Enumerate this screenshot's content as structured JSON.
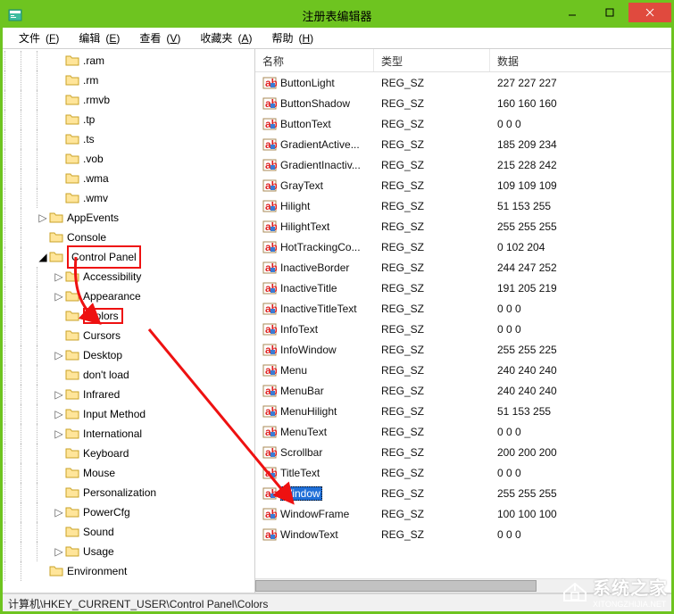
{
  "window": {
    "title": "注册表编辑器"
  },
  "menu": {
    "file": {
      "label": "文件",
      "accel": "F"
    },
    "edit": {
      "label": "编辑",
      "accel": "E"
    },
    "view": {
      "label": "查看",
      "accel": "V"
    },
    "favorites": {
      "label": "收藏夹",
      "accel": "A"
    },
    "help": {
      "label": "帮助",
      "accel": "H"
    }
  },
  "tree": {
    "ext_above": [
      ".ram",
      ".rm",
      ".rmvb",
      ".tp",
      ".ts",
      ".vob",
      ".wma",
      ".wmv"
    ],
    "nodes": [
      {
        "label": "AppEvents",
        "expander": "closed"
      },
      {
        "label": "Console",
        "expander": "none"
      }
    ],
    "control_panel": {
      "label": "Control Panel",
      "expander": "open",
      "highlight": true
    },
    "cp_children": [
      {
        "label": "Accessibility",
        "expander": "closed"
      },
      {
        "label": "Appearance",
        "expander": "closed"
      },
      {
        "label": "Colors",
        "expander": "none",
        "highlight": true
      },
      {
        "label": "Cursors",
        "expander": "none"
      },
      {
        "label": "Desktop",
        "expander": "closed"
      },
      {
        "label": "don't load",
        "expander": "none"
      },
      {
        "label": "Infrared",
        "expander": "closed"
      },
      {
        "label": "Input Method",
        "expander": "closed"
      },
      {
        "label": "International",
        "expander": "closed"
      },
      {
        "label": "Keyboard",
        "expander": "none"
      },
      {
        "label": "Mouse",
        "expander": "none"
      },
      {
        "label": "Personalization",
        "expander": "none"
      },
      {
        "label": "PowerCfg",
        "expander": "closed"
      },
      {
        "label": "Sound",
        "expander": "none"
      },
      {
        "label": "Usage",
        "expander": "closed"
      }
    ],
    "env": {
      "label": "Environment",
      "expander": "none"
    }
  },
  "list": {
    "columns": {
      "name": "名称",
      "type": "类型",
      "data": "数据"
    },
    "rows": [
      {
        "name": "ButtonLight",
        "type": "REG_SZ",
        "data": "227 227 227"
      },
      {
        "name": "ButtonShadow",
        "type": "REG_SZ",
        "data": "160 160 160"
      },
      {
        "name": "ButtonText",
        "type": "REG_SZ",
        "data": "0 0 0"
      },
      {
        "name": "GradientActive...",
        "type": "REG_SZ",
        "data": "185 209 234"
      },
      {
        "name": "GradientInactiv...",
        "type": "REG_SZ",
        "data": "215 228 242"
      },
      {
        "name": "GrayText",
        "type": "REG_SZ",
        "data": "109 109 109"
      },
      {
        "name": "Hilight",
        "type": "REG_SZ",
        "data": "51 153 255"
      },
      {
        "name": "HilightText",
        "type": "REG_SZ",
        "data": "255 255 255"
      },
      {
        "name": "HotTrackingCo...",
        "type": "REG_SZ",
        "data": "0 102 204"
      },
      {
        "name": "InactiveBorder",
        "type": "REG_SZ",
        "data": "244 247 252"
      },
      {
        "name": "InactiveTitle",
        "type": "REG_SZ",
        "data": "191 205 219"
      },
      {
        "name": "InactiveTitleText",
        "type": "REG_SZ",
        "data": "0 0 0"
      },
      {
        "name": "InfoText",
        "type": "REG_SZ",
        "data": "0 0 0"
      },
      {
        "name": "InfoWindow",
        "type": "REG_SZ",
        "data": "255 255 225"
      },
      {
        "name": "Menu",
        "type": "REG_SZ",
        "data": "240 240 240"
      },
      {
        "name": "MenuBar",
        "type": "REG_SZ",
        "data": "240 240 240"
      },
      {
        "name": "MenuHilight",
        "type": "REG_SZ",
        "data": "51 153 255"
      },
      {
        "name": "MenuText",
        "type": "REG_SZ",
        "data": "0 0 0"
      },
      {
        "name": "Scrollbar",
        "type": "REG_SZ",
        "data": "200 200 200"
      },
      {
        "name": "TitleText",
        "type": "REG_SZ",
        "data": "0 0 0"
      },
      {
        "name": "Window",
        "type": "REG_SZ",
        "data": "255 255 255",
        "selected": true
      },
      {
        "name": "WindowFrame",
        "type": "REG_SZ",
        "data": "100 100 100"
      },
      {
        "name": "WindowText",
        "type": "REG_SZ",
        "data": "0 0 0"
      }
    ]
  },
  "statusbar": {
    "path": "计算机\\HKEY_CURRENT_USER\\Control Panel\\Colors"
  },
  "watermark": {
    "text": "系统之家",
    "sub": "XITONGZHIJIA.NET"
  }
}
